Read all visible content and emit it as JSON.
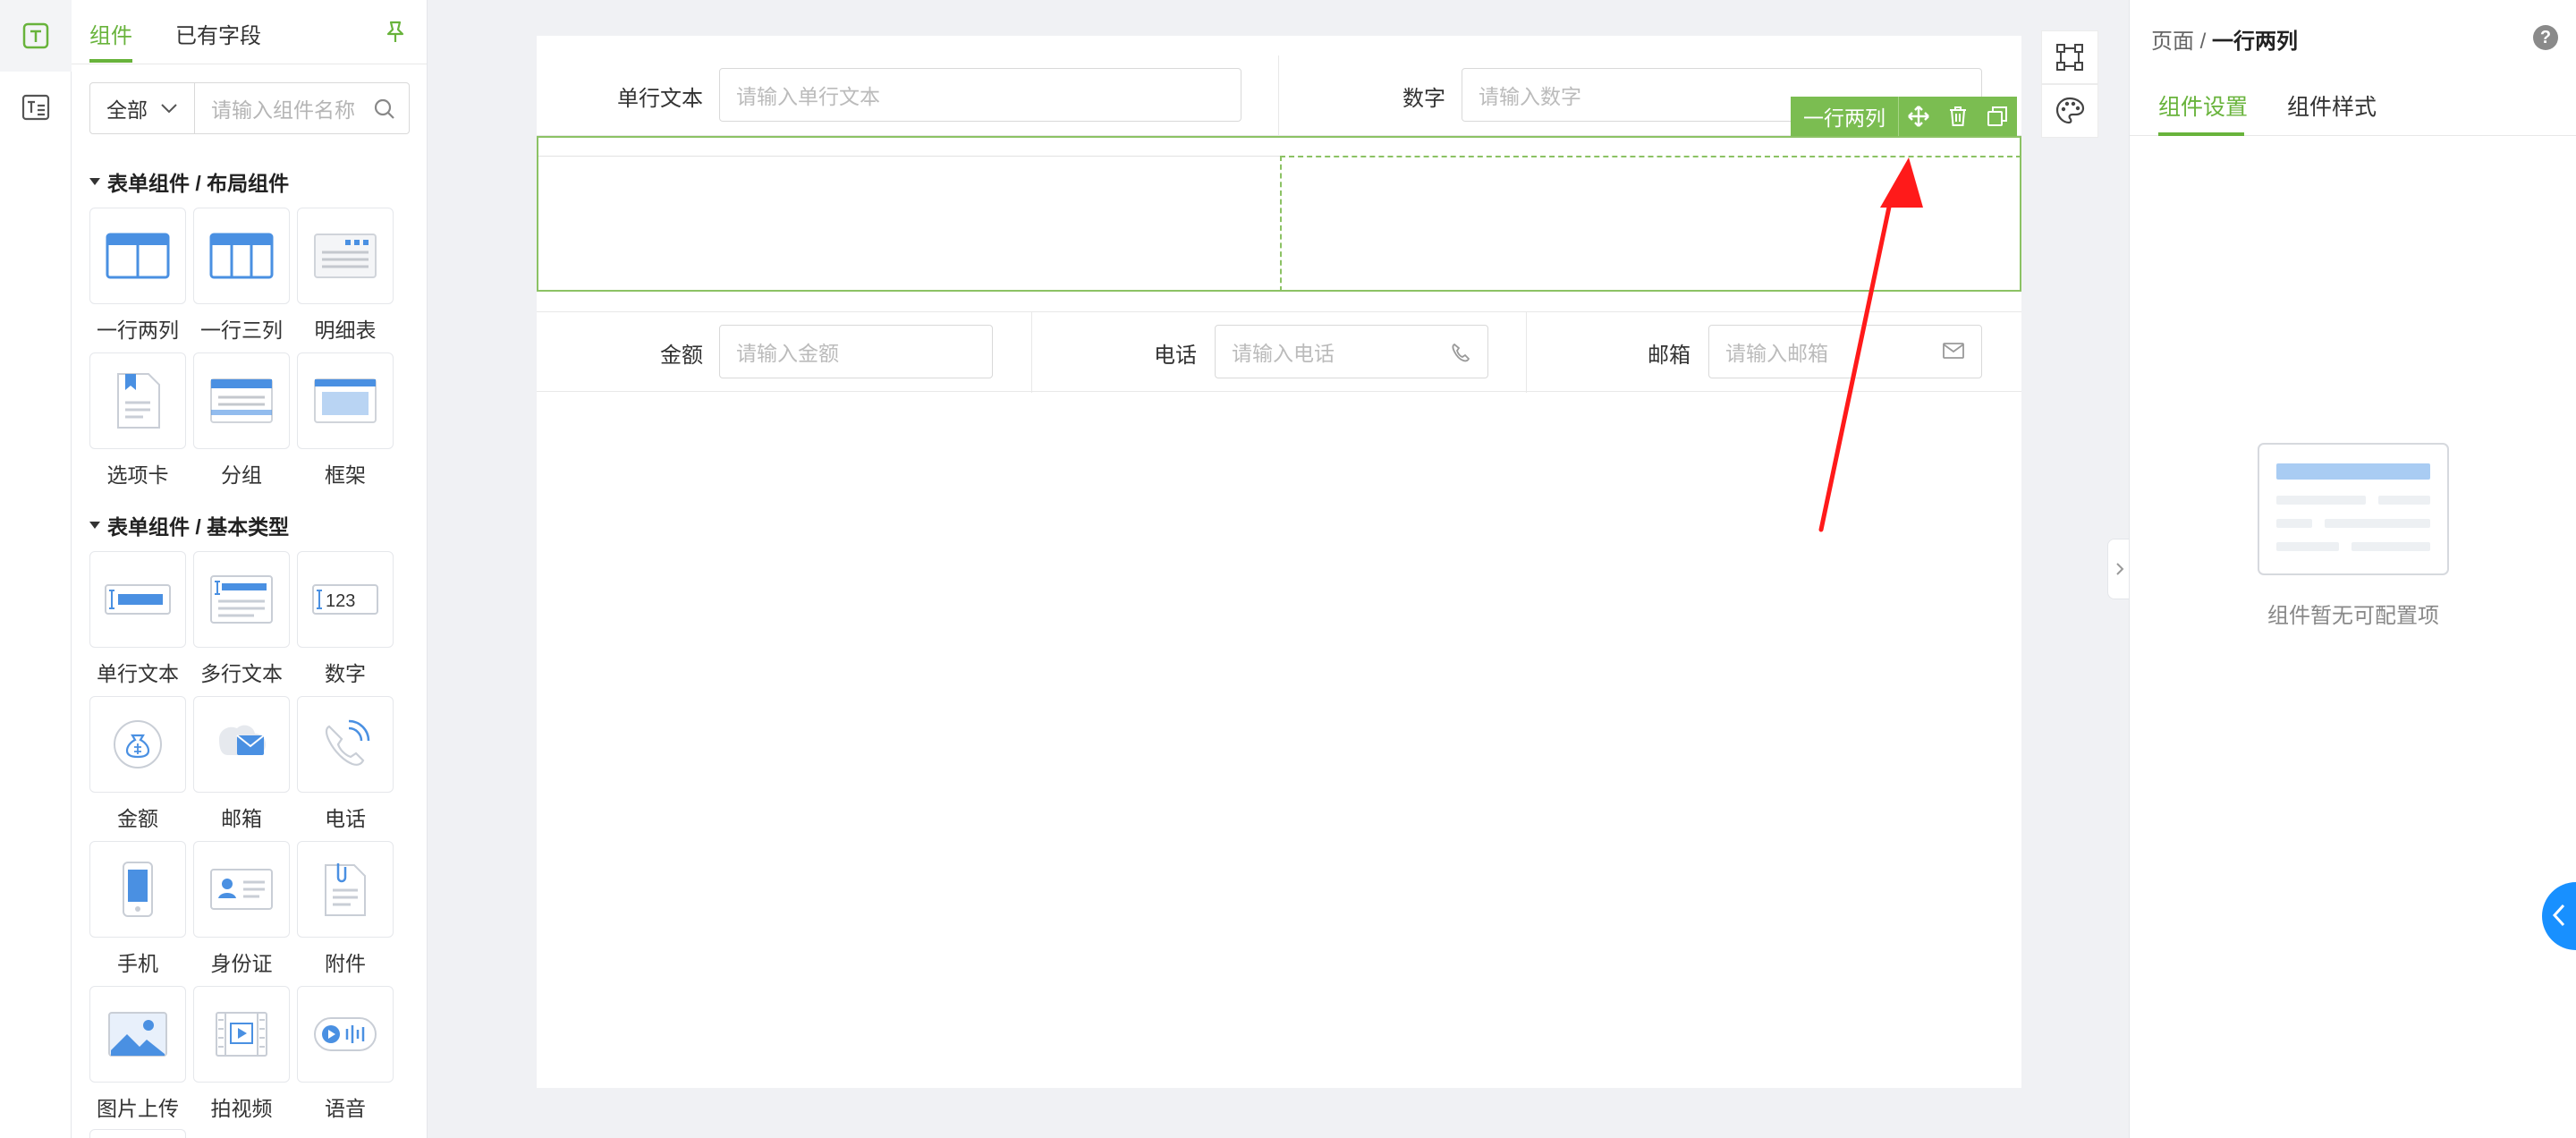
{
  "sidebar_panel": {
    "tabs": [
      "组件",
      "已有字段"
    ],
    "filter_select": "全部",
    "search_placeholder": "请输入组件名称",
    "sections": [
      {
        "title": "表单组件 / 布局组件",
        "items": [
          "一行两列",
          "一行三列",
          "明细表",
          "选项卡",
          "分组",
          "框架"
        ]
      },
      {
        "title": "表单组件 / 基本类型",
        "items": [
          "单行文本",
          "多行文本",
          "数字",
          "金额",
          "邮箱",
          "电话",
          "手机",
          "身份证",
          "附件",
          "图片上传",
          "拍视频",
          "语音"
        ]
      }
    ],
    "number_icon_text": "123"
  },
  "canvas": {
    "row1": {
      "fields": [
        {
          "label": "单行文本",
          "placeholder": "请输入单行文本"
        },
        {
          "label": "数字",
          "placeholder": "请输入数字"
        }
      ]
    },
    "selected_component": {
      "toolbar_label": "一行两列"
    },
    "row2": {
      "fields": [
        {
          "label": "金额",
          "placeholder": "请输入金额"
        },
        {
          "label": "电话",
          "placeholder": "请输入电话"
        },
        {
          "label": "邮箱",
          "placeholder": "请输入邮箱"
        }
      ]
    }
  },
  "right_panel": {
    "breadcrumb_root": "页面",
    "breadcrumb_sep": " / ",
    "breadcrumb_current": "一行两列",
    "help": "?",
    "tabs": [
      "组件设置",
      "组件样式"
    ],
    "empty_message": "组件暂无可配置项"
  },
  "colors": {
    "accent": "#68b33b",
    "selection_border": "#8cc264",
    "toolbar_bg": "#7bbd51",
    "annotation_arrow": "#ff0000",
    "fab": "#1890ff"
  }
}
